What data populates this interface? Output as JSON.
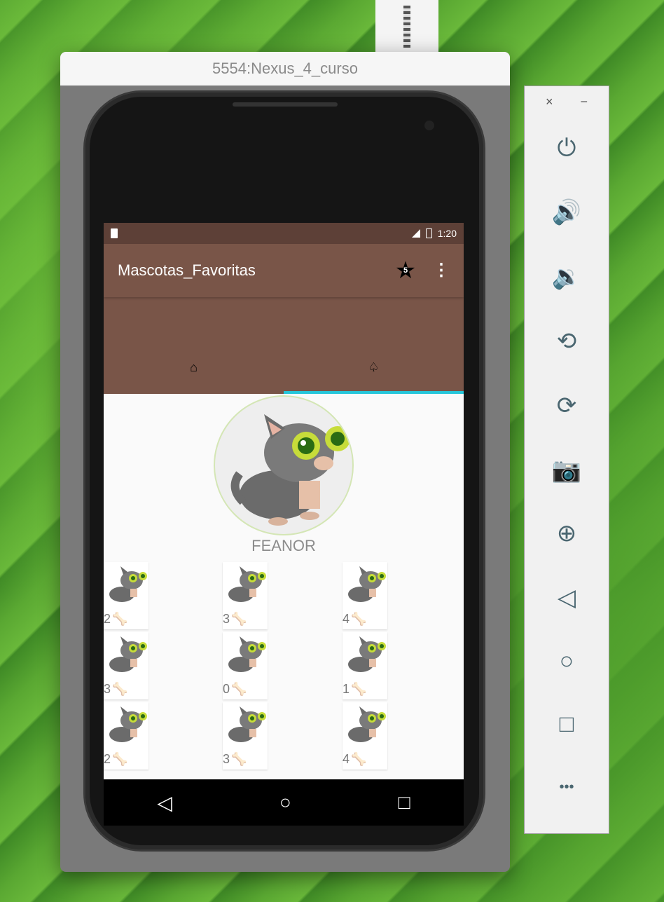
{
  "window": {
    "title": "5554:Nexus_4_curso"
  },
  "status_bar": {
    "time": "1:20"
  },
  "app_bar": {
    "title": "Mascotas_Favoritas",
    "badge_count": "5"
  },
  "tabs": [
    {
      "label": "⌂",
      "icon": "home-icon",
      "selected": false
    },
    {
      "label": "♤",
      "icon": "pet-icon",
      "selected": true
    }
  ],
  "profile": {
    "pet_name": "FEANOR"
  },
  "grid": {
    "items": [
      {
        "likes": "2"
      },
      {
        "likes": "3"
      },
      {
        "likes": "4"
      },
      {
        "likes": "3"
      },
      {
        "likes": "0"
      },
      {
        "likes": "1"
      },
      {
        "likes": "2"
      },
      {
        "likes": "3"
      },
      {
        "likes": "4"
      }
    ]
  },
  "nav": {
    "back": "◁",
    "home": "○",
    "recents": "□"
  },
  "emulator_panel": {
    "close": "×",
    "minimize": "−",
    "buttons": [
      {
        "icon": "power-icon",
        "glyph": "⏻"
      },
      {
        "icon": "volume-up-icon",
        "glyph": "🔊"
      },
      {
        "icon": "volume-down-icon",
        "glyph": "🔉"
      },
      {
        "icon": "rotate-left-icon",
        "glyph": "⟲"
      },
      {
        "icon": "rotate-right-icon",
        "glyph": "⟳"
      },
      {
        "icon": "camera-icon",
        "glyph": "📷"
      },
      {
        "icon": "zoom-icon",
        "glyph": "⊕"
      },
      {
        "icon": "back-icon",
        "glyph": "◁"
      },
      {
        "icon": "home-icon",
        "glyph": "○"
      },
      {
        "icon": "overview-icon",
        "glyph": "□"
      },
      {
        "icon": "more-icon",
        "glyph": "•••"
      }
    ]
  },
  "colors": {
    "status_bar": "#5d4037",
    "app_bar": "#795548",
    "tab_indicator": "#26c6da"
  }
}
